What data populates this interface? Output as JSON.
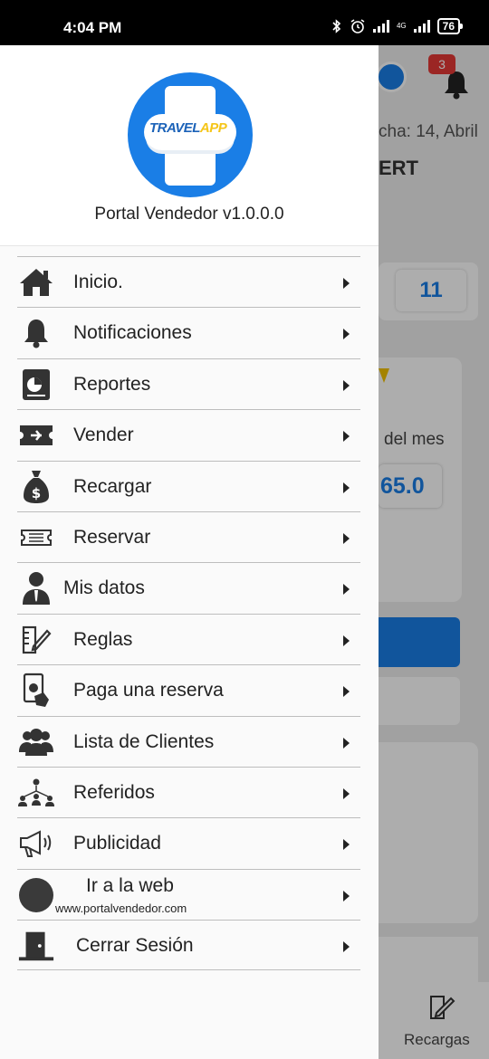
{
  "status_bar": {
    "time": "4:04 PM",
    "network": "4G",
    "battery": "76"
  },
  "background": {
    "notification_count": "3",
    "fecha_text": "cha: 14, Abril",
    "cert_text": "ERT",
    "count_value": "11",
    "mes_text": "del mes",
    "amount_text": "65.0",
    "nav_label": "Recargas"
  },
  "drawer": {
    "logo_text_1": "TRAVEL",
    "logo_text_2": "APP",
    "version": "Portal Vendedor v1.0.0.0",
    "menu": [
      {
        "label": "Inicio.",
        "icon": "home-icon"
      },
      {
        "label": "Notificaciones",
        "icon": "bell-icon"
      },
      {
        "label": "Reportes",
        "icon": "report-icon"
      },
      {
        "label": "Vender",
        "icon": "ticket-sell-icon"
      },
      {
        "label": "Recargar",
        "icon": "money-bag-icon"
      },
      {
        "label": "Reservar",
        "icon": "ticket-reserve-icon"
      },
      {
        "label": "Mis datos",
        "icon": "user-icon"
      },
      {
        "label": "Reglas",
        "icon": "rules-icon"
      },
      {
        "label": "Paga una reserva",
        "icon": "pay-icon"
      },
      {
        "label": "Lista de Clientes",
        "icon": "clients-icon"
      },
      {
        "label": "Referidos",
        "icon": "referrals-icon"
      },
      {
        "label": "Publicidad",
        "icon": "megaphone-icon"
      },
      {
        "label": "Ir a la web",
        "sublabel": "www.portalvendedor.com",
        "icon": "web-icon"
      },
      {
        "label": "Cerrar Sesión",
        "icon": "logout-door-icon"
      }
    ]
  },
  "colors": {
    "brand_blue": "#1a7ee6",
    "badge_red": "#e53935",
    "logo_yellow": "#f5c518"
  }
}
